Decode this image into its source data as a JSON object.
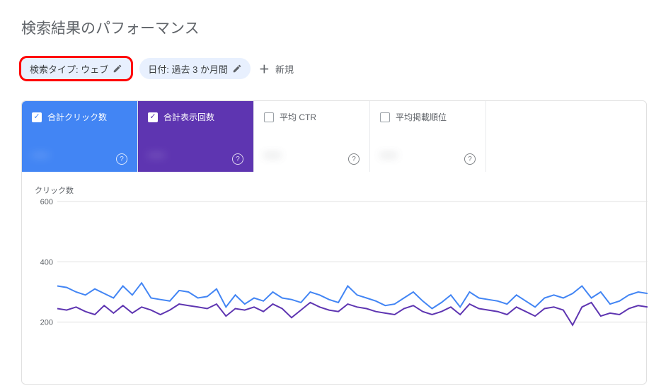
{
  "page_title": "検索結果のパフォーマンス",
  "filters": {
    "search_type": {
      "label": "検索タイプ: ウェブ"
    },
    "date": {
      "label": "日付: 過去 3 か月間"
    },
    "add": {
      "label": "新規"
    }
  },
  "metrics": [
    {
      "label": "合計クリック数",
      "value": "—",
      "checked": true,
      "color": "blue"
    },
    {
      "label": "合計表示回数",
      "value": "—",
      "checked": true,
      "color": "purple"
    },
    {
      "label": "平均 CTR",
      "value": "—",
      "checked": false
    },
    {
      "label": "平均掲載順位",
      "value": "—",
      "checked": false
    }
  ],
  "chart_data": {
    "type": "line",
    "title": "クリック数",
    "ylabel": "",
    "ylim": [
      0,
      600
    ],
    "yticks": [
      600,
      400,
      200
    ],
    "x": [
      0,
      1,
      2,
      3,
      4,
      5,
      6,
      7,
      8,
      9,
      10,
      11,
      12,
      13,
      14,
      15,
      16,
      17,
      18,
      19,
      20,
      21,
      22,
      23,
      24,
      25,
      26,
      27,
      28,
      29,
      30,
      31,
      32,
      33,
      34,
      35,
      36,
      37,
      38,
      39,
      40,
      41,
      42,
      43,
      44,
      45,
      46,
      47,
      48,
      49,
      50,
      51,
      52,
      53,
      54,
      55,
      56,
      57,
      58,
      59,
      60,
      61,
      62,
      63
    ],
    "series": [
      {
        "name": "合計クリック数",
        "color": "#4285f4",
        "values": [
          320,
          315,
          300,
          290,
          310,
          295,
          280,
          320,
          290,
          330,
          280,
          275,
          270,
          305,
          300,
          280,
          285,
          310,
          250,
          290,
          260,
          280,
          270,
          300,
          280,
          275,
          265,
          300,
          290,
          275,
          265,
          320,
          290,
          280,
          270,
          255,
          260,
          280,
          300,
          270,
          245,
          265,
          290,
          250,
          300,
          280,
          275,
          270,
          260,
          290,
          270,
          250,
          280,
          290,
          280,
          295,
          320,
          280,
          300,
          260,
          270,
          290,
          300,
          295
        ]
      },
      {
        "name": "合計表示回数",
        "color": "#5e35b1",
        "values": [
          245,
          240,
          250,
          235,
          225,
          255,
          230,
          255,
          230,
          250,
          240,
          225,
          240,
          260,
          255,
          250,
          245,
          260,
          220,
          245,
          240,
          250,
          235,
          260,
          245,
          215,
          240,
          265,
          250,
          240,
          235,
          260,
          250,
          245,
          235,
          230,
          225,
          245,
          255,
          235,
          225,
          235,
          250,
          225,
          260,
          245,
          240,
          235,
          225,
          250,
          235,
          220,
          245,
          250,
          240,
          190,
          250,
          265,
          220,
          230,
          225,
          245,
          255,
          250
        ]
      }
    ]
  }
}
